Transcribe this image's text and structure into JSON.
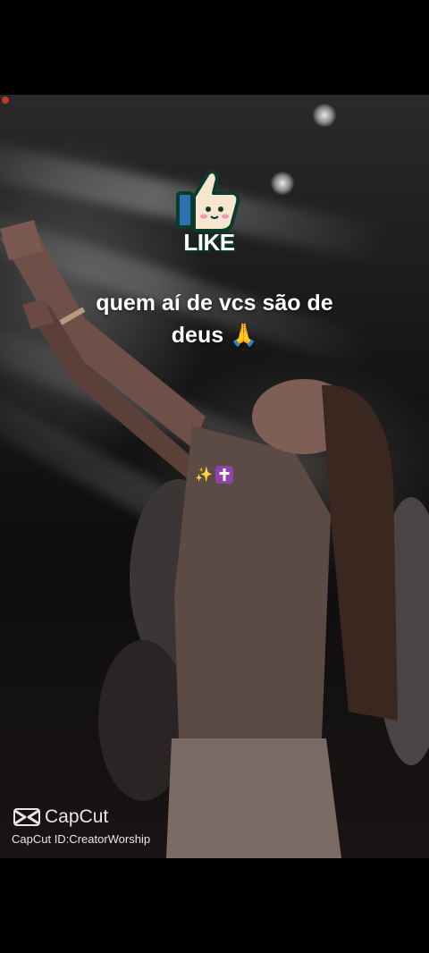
{
  "video": {
    "sticker": {
      "icon": "thumbs-up-icon",
      "label": "LIKE",
      "accent": "#1b7f5d"
    },
    "caption_line1": "quem aí de vcs são de",
    "caption_line2": "deus 🙏",
    "decor": {
      "sparkle": "✨",
      "cross_icon": "latin-cross-icon",
      "cross_color": "#8e44ad"
    },
    "watermark": {
      "logo_icon": "capcut-icon",
      "brand": "CapCut",
      "id_text": "CapCut ID:CreatorWorship"
    }
  }
}
